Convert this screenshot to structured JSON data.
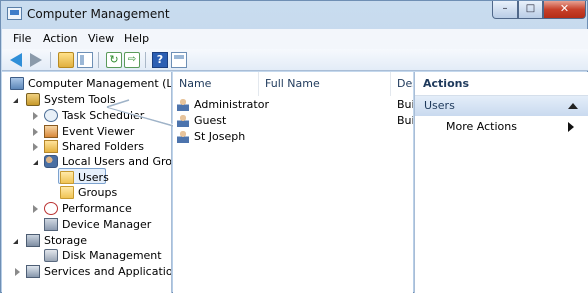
{
  "window": {
    "title": "Computer Management",
    "controls": {
      "minimize": "–",
      "maximize": "□",
      "close": "✕"
    }
  },
  "menu": [
    "File",
    "Action",
    "View",
    "Help"
  ],
  "toolbar": {
    "refresh_glyph": "↻",
    "export_glyph": "⇨",
    "help_glyph": "?"
  },
  "tree": {
    "root": "Computer Management (Local",
    "system_tools": "System Tools",
    "task_scheduler": "Task Scheduler",
    "event_viewer": "Event Viewer",
    "shared_folders": "Shared Folders",
    "local_users_groups": "Local Users and Groups",
    "users": "Users",
    "groups": "Groups",
    "performance": "Performance",
    "device_manager": "Device Manager",
    "storage": "Storage",
    "disk_management": "Disk Management",
    "services_apps": "Services and Applications"
  },
  "list": {
    "columns": {
      "name": "Name",
      "full_name": "Full Name",
      "description": "Des"
    },
    "rows": [
      {
        "name": "Administrator",
        "full_name": "",
        "description": "Bui"
      },
      {
        "name": "Guest",
        "full_name": "",
        "description": "Bui"
      },
      {
        "name": "St Joseph",
        "full_name": "",
        "description": ""
      }
    ]
  },
  "actions": {
    "header": "Actions",
    "section": "Users",
    "more_actions": "More Actions"
  },
  "colors": {
    "accent": "#2f8fd8",
    "window_frame": "#b4cce6",
    "actions_section": "#c9daef"
  }
}
